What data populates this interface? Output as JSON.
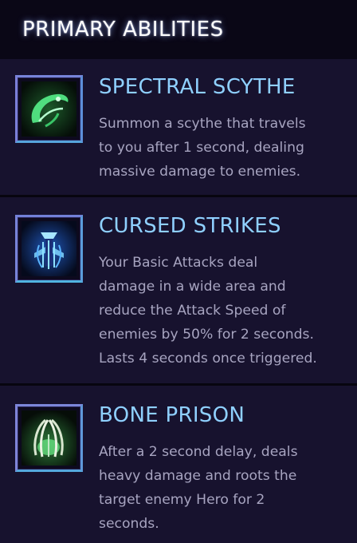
{
  "header": {
    "title": "PRIMARY ABILITIES"
  },
  "abilities": [
    {
      "title": "SPECTRAL SCYTHE",
      "icon": "spectral-scythe-icon",
      "description_lines": [
        "Summon a scythe that travels",
        "to you after 1 second, dealing",
        "massive damage to enemies."
      ]
    },
    {
      "title": "CURSED STRIKES",
      "icon": "cursed-strikes-icon",
      "description_lines": [
        "Your Basic Attacks deal",
        "damage in a wide area and",
        "reduce the Attack Speed of",
        "enemies by 50% for 2 seconds.",
        "Lasts 4 seconds once triggered."
      ]
    },
    {
      "title": "BONE PRISON",
      "icon": "bone-prison-icon",
      "description_lines": [
        "After a 2 second delay, deals",
        "heavy damage and roots the",
        "target enemy Hero for 2",
        "seconds."
      ]
    }
  ],
  "colors": {
    "title": "#8fd0ff",
    "description": "#a7a4c0",
    "background": "#17122e",
    "header_background": "#0a0716"
  }
}
